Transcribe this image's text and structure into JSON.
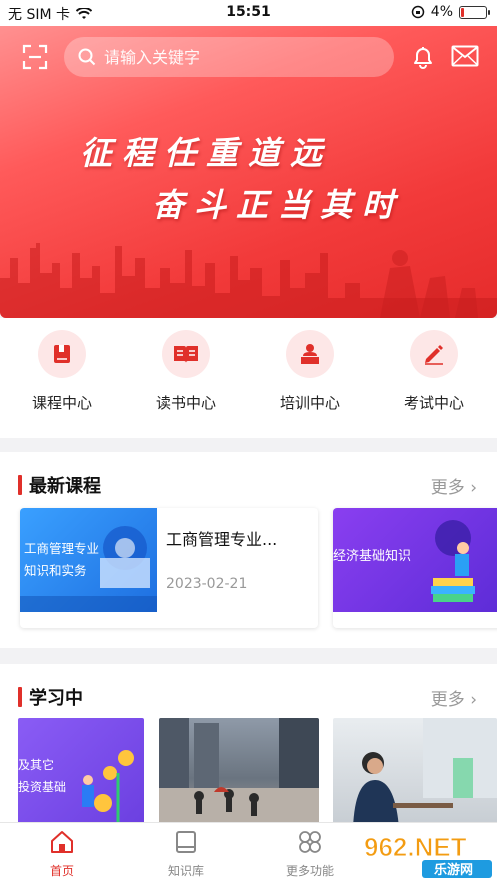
{
  "status_bar": {
    "carrier": "无 SIM 卡",
    "time": "15:51",
    "battery": "4%"
  },
  "search": {
    "placeholder": "请输入关键字"
  },
  "banner": {
    "line1": "征程任重道远",
    "line2": "奋斗正当其时"
  },
  "quick_nav": [
    {
      "label": "课程中心",
      "icon": "book-icon"
    },
    {
      "label": "读书中心",
      "icon": "open-book-icon"
    },
    {
      "label": "培训中心",
      "icon": "lecturer-icon"
    },
    {
      "label": "考试中心",
      "icon": "pencil-icon"
    }
  ],
  "latest_courses": {
    "title": "最新课程",
    "more": "更多",
    "items": [
      {
        "thumb_text": "工商管理专业\n知识和实务",
        "title": "工商管理专业...",
        "date": "2023-02-21"
      },
      {
        "thumb_text": "经济基础知识"
      }
    ]
  },
  "studying": {
    "title": "学习中",
    "more": "更多",
    "items": [
      {
        "thumb_text": "及其它\n投资基础"
      },
      {
        "thumb_text": ""
      },
      {
        "thumb_text": ""
      }
    ]
  },
  "tab_bar": [
    {
      "label": "首页",
      "icon": "home-icon",
      "active": true
    },
    {
      "label": "知识库",
      "icon": "library-icon",
      "active": false
    },
    {
      "label": "更多功能",
      "icon": "grid-icon",
      "active": false
    }
  ],
  "watermark": {
    "text": "962.NET",
    "subtext": "乐游网"
  },
  "colors": {
    "accent": "#e0302a",
    "banner": "#f23a3a",
    "muted": "#999999"
  }
}
